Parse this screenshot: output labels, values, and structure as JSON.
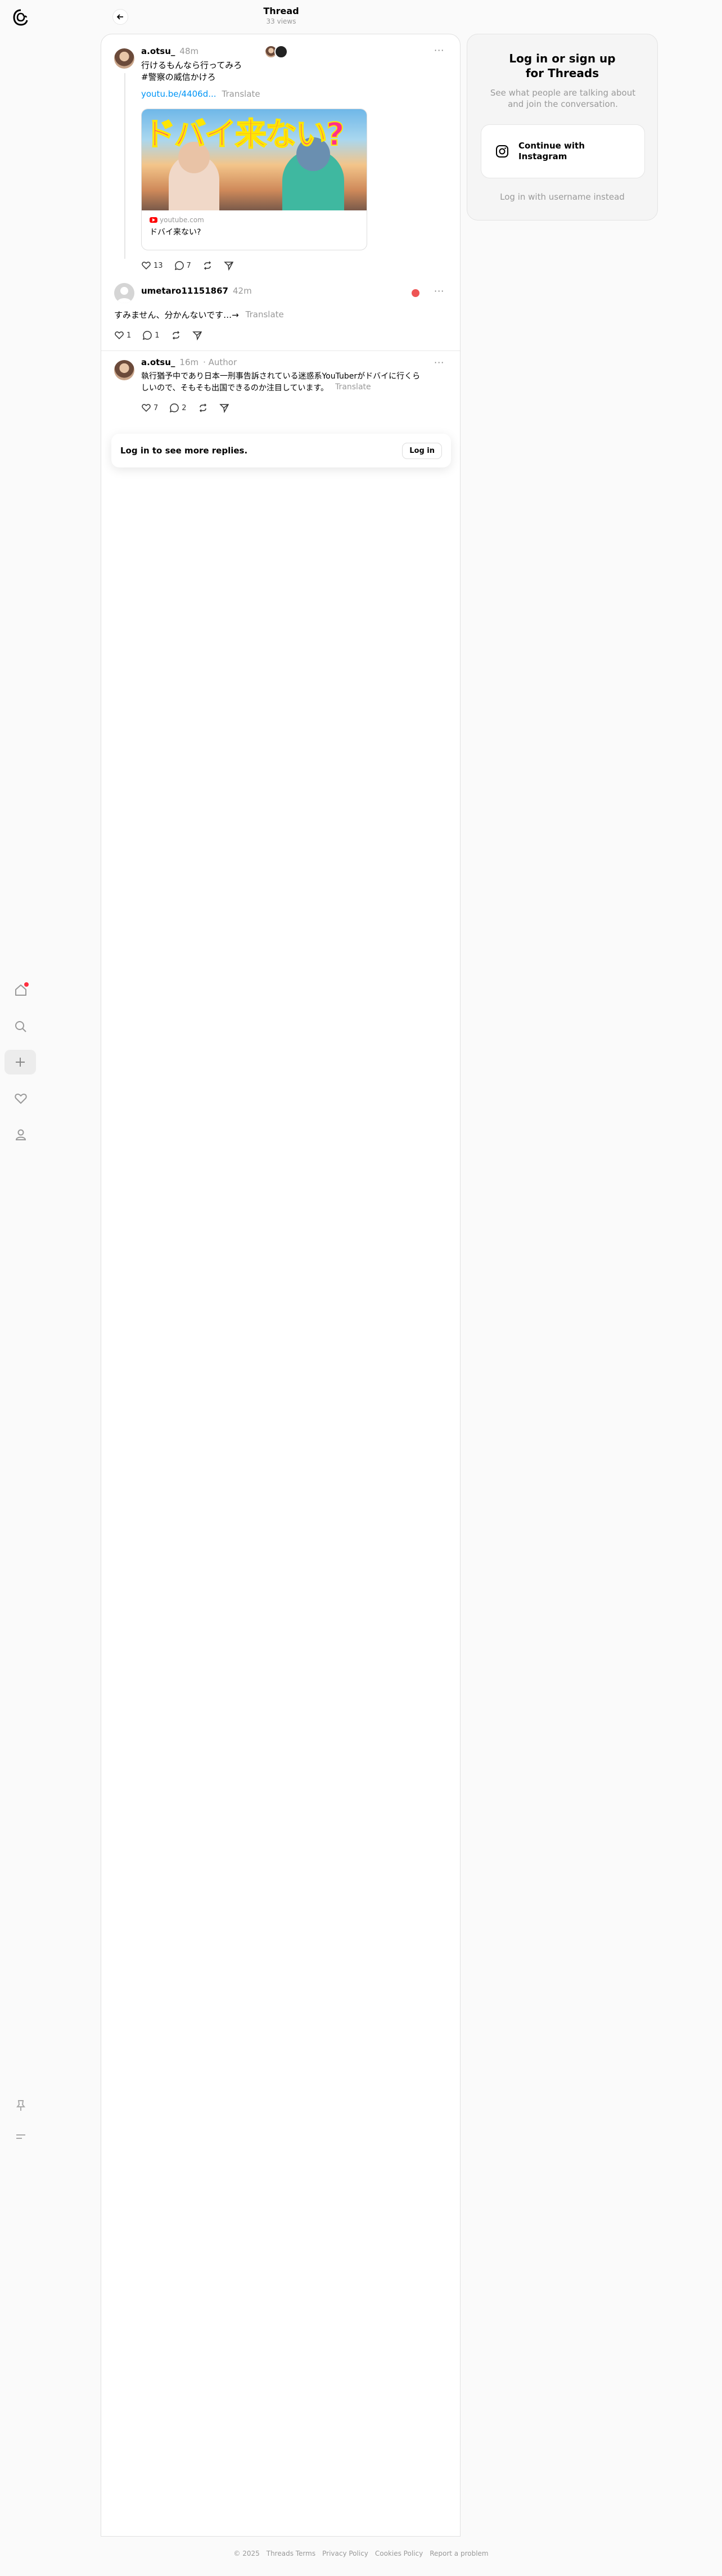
{
  "header": {
    "title": "Thread",
    "views": "33 views"
  },
  "nav": {
    "items": [
      {
        "name": "home-icon"
      },
      {
        "name": "search-icon"
      },
      {
        "name": "create-icon"
      },
      {
        "name": "heart-icon"
      },
      {
        "name": "profile-icon"
      },
      {
        "name": "pin-icon"
      },
      {
        "name": "menu-icon"
      }
    ]
  },
  "post": {
    "username": "a.otsu_",
    "time": "48m",
    "text_line1": "行けるもんなら行ってみろ",
    "text_line2": "#警察の威信かけろ",
    "link": "youtu.be/4406d...",
    "translate": "Translate",
    "card": {
      "thumb_text": "ドバイ来ない?",
      "domain": "youtube.com",
      "title": "ドバイ来ない?"
    },
    "likes": "13",
    "replies": "7"
  },
  "reply1": {
    "username": "umetaro11151867",
    "time": "42m",
    "text": "すみません、分かんないです…→",
    "translate": "Translate",
    "likes": "1",
    "replies": "1"
  },
  "reply2": {
    "username": "a.otsu_",
    "time": "16m",
    "author_tag": "· Author",
    "text_line1": "執行猶予中であり日本一刑事告訴されている迷惑系YouTuberがドバイに行くら",
    "text_line2": "しいので、そもそも出国できるのか注目しています。",
    "translate": "Translate",
    "likes": "7",
    "replies": "2"
  },
  "login_bar": {
    "text": "Log in to see more replies.",
    "button": "Log in"
  },
  "right_panel": {
    "title_line1": "Log in or sign up",
    "title_line2": "for Threads",
    "subtitle": "See what people are talking about and join the conversation.",
    "instagram_button": "Continue with Instagram",
    "alt_login": "Log in with username instead"
  },
  "footer": {
    "copyright": "© 2025",
    "terms": "Threads Terms",
    "privacy": "Privacy Policy",
    "cookies": "Cookies Policy",
    "report": "Report a problem"
  }
}
